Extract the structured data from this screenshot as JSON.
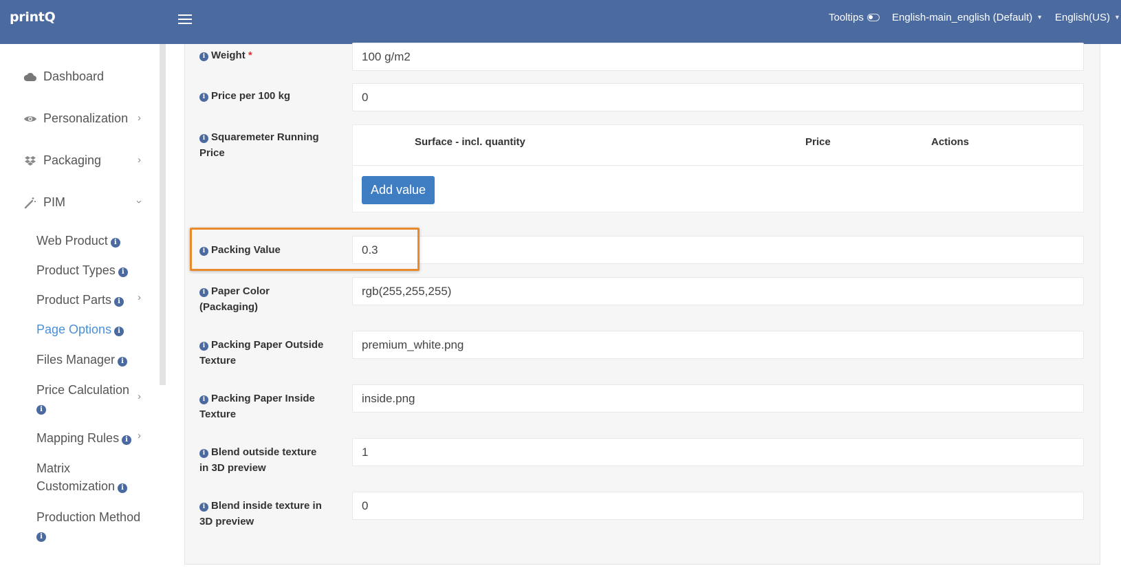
{
  "header": {
    "brand": "printQ",
    "tooltips_label": "Tooltips",
    "language_profile": "English-main_english (Default)",
    "locale": "English(US)"
  },
  "sidebar": {
    "items": [
      {
        "label": "Dashboard",
        "icon": "cloud-icon"
      },
      {
        "label": "Personalization",
        "icon": "eye-icon"
      },
      {
        "label": "Packaging",
        "icon": "dropbox-icon"
      },
      {
        "label": "PIM",
        "icon": "magic-wand-icon"
      }
    ],
    "pim_sub": [
      {
        "label": "Web Product"
      },
      {
        "label": "Product Types"
      },
      {
        "label": "Product Parts"
      },
      {
        "label": "Page Options"
      },
      {
        "label": "Files Manager"
      },
      {
        "label": "Price Calculation"
      },
      {
        "label": "Mapping Rules"
      },
      {
        "label": "Matrix Customization"
      },
      {
        "label": "Production Method"
      }
    ],
    "active": "Page Options"
  },
  "form": {
    "weight": {
      "label": "Weight",
      "required_mark": "*",
      "value": "100 g/m2"
    },
    "price_per_100kg": {
      "label": "Price per 100 kg",
      "value": "0"
    },
    "sqm_price": {
      "label": "Squaremeter Running Price",
      "columns": [
        "Surface - incl. quantity",
        "Price",
        "Actions"
      ],
      "add_button": "Add value"
    },
    "packing_value": {
      "label": "Packing Value",
      "value": "0.3"
    },
    "paper_color": {
      "label": "Paper Color (Packaging)",
      "value": "rgb(255,255,255)"
    },
    "outside_texture": {
      "label": "Packing Paper Outside Texture",
      "value": "premium_white.png"
    },
    "inside_texture": {
      "label": "Packing Paper Inside Texture",
      "value": "inside.png"
    },
    "blend_outside": {
      "label": "Blend outside texture in 3D preview",
      "value": "1"
    },
    "blend_inside": {
      "label": "Blend inside texture in 3D preview",
      "value": "0"
    }
  },
  "colors": {
    "topbar": "#4a6aa0",
    "active_link": "#4a8fd4",
    "button": "#3f7dc2",
    "highlight": "#e8892b"
  }
}
